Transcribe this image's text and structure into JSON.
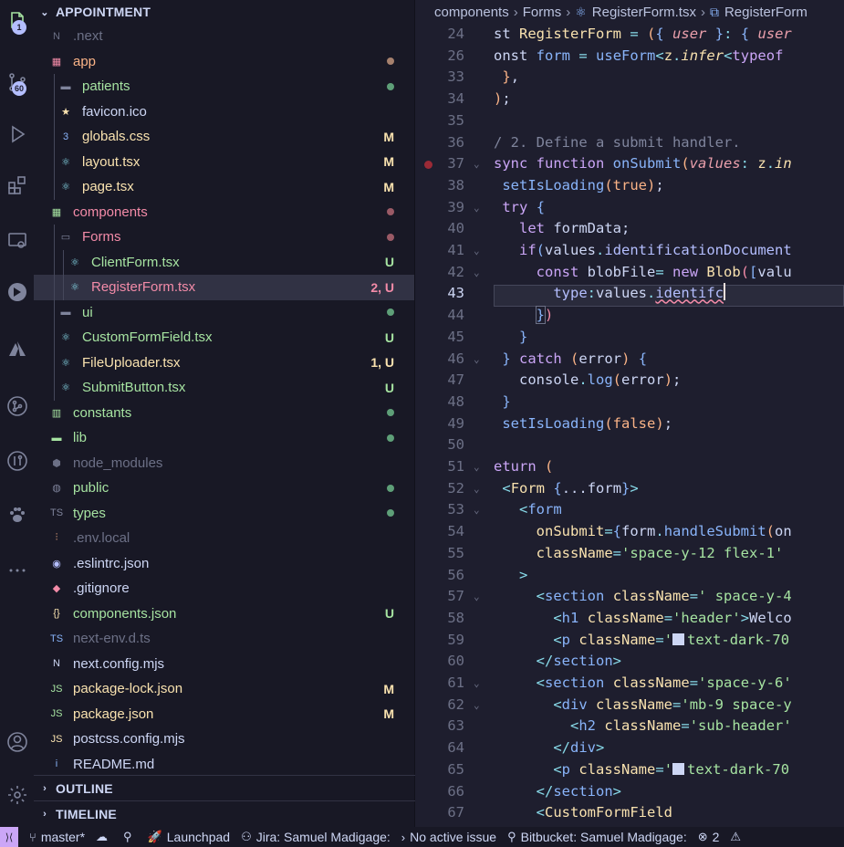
{
  "activity_bar": {
    "items": [
      {
        "icon": "explorer-icon",
        "badge": "1"
      },
      {
        "icon": "source-control-icon",
        "badge": "60"
      },
      {
        "icon": "run-debug-icon",
        "badge": ""
      },
      {
        "icon": "extensions-icon",
        "badge": ""
      },
      {
        "icon": "remote-explorer-icon",
        "badge": ""
      },
      {
        "icon": "gitkraken-icon",
        "badge": ""
      },
      {
        "icon": "atlassian-icon",
        "badge": ""
      },
      {
        "icon": "git-graph-icon",
        "badge": ""
      },
      {
        "icon": "pull-request-icon",
        "badge": ""
      },
      {
        "icon": "paw-icon",
        "badge": ""
      },
      {
        "icon": "more-icon",
        "badge": ""
      }
    ],
    "bottom": [
      {
        "icon": "accounts-icon"
      },
      {
        "icon": "settings-gear-icon"
      }
    ]
  },
  "explorer": {
    "section_title": "APPOINTMENT",
    "items": [
      {
        "label": ".next",
        "icon": "folder-next-icon",
        "icon_glyph": "N",
        "icon_color": "#6c7086",
        "color": "#6c7086",
        "depth": 0,
        "status": "",
        "status_color": "",
        "dot": ""
      },
      {
        "label": "app",
        "icon": "folder-app-icon",
        "icon_glyph": "▦",
        "icon_color": "#f38ba8",
        "color": "#fab387",
        "depth": 0,
        "status": "",
        "status_color": "",
        "dot": "#a6816e"
      },
      {
        "label": "patients",
        "icon": "folder-icon",
        "icon_glyph": "▬",
        "icon_color": "#7f849c",
        "color": "#a6e3a1",
        "depth": 1,
        "status": "",
        "status_color": "",
        "dot": "#5e9f78"
      },
      {
        "label": "favicon.ico",
        "icon": "star-icon",
        "icon_glyph": "★",
        "icon_color": "#f9e2af",
        "color": "#cdd6f4",
        "depth": 1,
        "status": "",
        "status_color": "",
        "dot": ""
      },
      {
        "label": "globals.css",
        "icon": "css-icon",
        "icon_glyph": "3",
        "icon_color": "#89b4fa",
        "color": "#f9e2af",
        "depth": 1,
        "status": "M",
        "status_color": "#f9e2af",
        "dot": ""
      },
      {
        "label": "layout.tsx",
        "icon": "react-icon",
        "icon_glyph": "⚛",
        "icon_color": "#89dceb",
        "color": "#f9e2af",
        "depth": 1,
        "status": "M",
        "status_color": "#f9e2af",
        "dot": ""
      },
      {
        "label": "page.tsx",
        "icon": "react-icon",
        "icon_glyph": "⚛",
        "icon_color": "#89dceb",
        "color": "#f9e2af",
        "depth": 1,
        "status": "M",
        "status_color": "#f9e2af",
        "dot": ""
      },
      {
        "label": "components",
        "icon": "folder-components-icon",
        "icon_glyph": "▦",
        "icon_color": "#a6e3a1",
        "color": "#f38ba8",
        "depth": 0,
        "status": "",
        "status_color": "",
        "dot": "#9a5a66"
      },
      {
        "label": "Forms",
        "icon": "folder-open-icon",
        "icon_glyph": "▭",
        "icon_color": "#7f849c",
        "color": "#f38ba8",
        "depth": 1,
        "status": "",
        "status_color": "",
        "dot": "#9a5a66"
      },
      {
        "label": "ClientForm.tsx",
        "icon": "react-icon",
        "icon_glyph": "⚛",
        "icon_color": "#89dceb",
        "color": "#a6e3a1",
        "depth": 2,
        "status": "U",
        "status_color": "#a6e3a1",
        "dot": ""
      },
      {
        "label": "RegisterForm.tsx",
        "icon": "react-icon",
        "icon_glyph": "⚛",
        "icon_color": "#89dceb",
        "color": "#f38ba8",
        "depth": 2,
        "status": "2, U",
        "status_color": "#f38ba8",
        "dot": "",
        "selected": true
      },
      {
        "label": "ui",
        "icon": "folder-icon",
        "icon_glyph": "▬",
        "icon_color": "#7f849c",
        "color": "#a6e3a1",
        "depth": 1,
        "status": "",
        "status_color": "",
        "dot": "#5e9f78"
      },
      {
        "label": "CustomFormField.tsx",
        "icon": "react-icon",
        "icon_glyph": "⚛",
        "icon_color": "#89dceb",
        "color": "#a6e3a1",
        "depth": 1,
        "status": "U",
        "status_color": "#a6e3a1",
        "dot": ""
      },
      {
        "label": "FileUploader.tsx",
        "icon": "react-icon",
        "icon_glyph": "⚛",
        "icon_color": "#89dceb",
        "color": "#f9e2af",
        "depth": 1,
        "status": "1, U",
        "status_color": "#f9e2af",
        "dot": ""
      },
      {
        "label": "SubmitButton.tsx",
        "icon": "react-icon",
        "icon_glyph": "⚛",
        "icon_color": "#89dceb",
        "color": "#a6e3a1",
        "depth": 1,
        "status": "U",
        "status_color": "#a6e3a1",
        "dot": ""
      },
      {
        "label": "constants",
        "icon": "folder-constants-icon",
        "icon_glyph": "▥",
        "icon_color": "#a6e3a1",
        "color": "#a6e3a1",
        "depth": 0,
        "status": "",
        "status_color": "",
        "dot": "#5e9f78"
      },
      {
        "label": "lib",
        "icon": "folder-lib-icon",
        "icon_glyph": "▬",
        "icon_color": "#a6e3a1",
        "color": "#a6e3a1",
        "depth": 0,
        "status": "",
        "status_color": "",
        "dot": "#5e9f78"
      },
      {
        "label": "node_modules",
        "icon": "folder-node-icon",
        "icon_glyph": "⬢",
        "icon_color": "#6c7086",
        "color": "#6c7086",
        "depth": 0,
        "status": "",
        "status_color": "",
        "dot": ""
      },
      {
        "label": "public",
        "icon": "folder-public-icon",
        "icon_glyph": "◍",
        "icon_color": "#7f849c",
        "color": "#a6e3a1",
        "depth": 0,
        "status": "",
        "status_color": "",
        "dot": "#5e9f78"
      },
      {
        "label": "types",
        "icon": "folder-types-icon",
        "icon_glyph": "TS",
        "icon_color": "#7f849c",
        "color": "#a6e3a1",
        "depth": 0,
        "status": "",
        "status_color": "",
        "dot": "#5e9f78"
      },
      {
        "label": ".env.local",
        "icon": "env-icon",
        "icon_glyph": "⫶",
        "icon_color": "#fab387",
        "color": "#6c7086",
        "depth": 0,
        "status": "",
        "status_color": "",
        "dot": ""
      },
      {
        "label": ".eslintrc.json",
        "icon": "eslint-icon",
        "icon_glyph": "◉",
        "icon_color": "#b4befe",
        "color": "#cdd6f4",
        "depth": 0,
        "status": "",
        "status_color": "",
        "dot": ""
      },
      {
        "label": ".gitignore",
        "icon": "git-icon",
        "icon_glyph": "◆",
        "icon_color": "#f38ba8",
        "color": "#cdd6f4",
        "depth": 0,
        "status": "",
        "status_color": "",
        "dot": ""
      },
      {
        "label": "components.json",
        "icon": "json-icon",
        "icon_glyph": "{}",
        "icon_color": "#f9e2af",
        "color": "#a6e3a1",
        "depth": 0,
        "status": "U",
        "status_color": "#a6e3a1",
        "dot": ""
      },
      {
        "label": "next-env.d.ts",
        "icon": "typescript-def-icon",
        "icon_glyph": "TS",
        "icon_color": "#89b4fa",
        "color": "#6c7086",
        "depth": 0,
        "status": "",
        "status_color": "",
        "dot": ""
      },
      {
        "label": "next.config.mjs",
        "icon": "next-icon",
        "icon_glyph": "N",
        "icon_color": "#cdd6f4",
        "color": "#cdd6f4",
        "depth": 0,
        "status": "",
        "status_color": "",
        "dot": ""
      },
      {
        "label": "package-lock.json",
        "icon": "nodejs-icon",
        "icon_glyph": "JS",
        "icon_color": "#a6e3a1",
        "color": "#f9e2af",
        "depth": 0,
        "status": "M",
        "status_color": "#f9e2af",
        "dot": ""
      },
      {
        "label": "package.json",
        "icon": "nodejs-icon",
        "icon_glyph": "JS",
        "icon_color": "#a6e3a1",
        "color": "#f9e2af",
        "depth": 0,
        "status": "M",
        "status_color": "#f9e2af",
        "dot": ""
      },
      {
        "label": "postcss.config.mjs",
        "icon": "js-icon",
        "icon_glyph": "JS",
        "icon_color": "#f9e2af",
        "color": "#cdd6f4",
        "depth": 0,
        "status": "",
        "status_color": "",
        "dot": ""
      },
      {
        "label": "README.md",
        "icon": "info-icon",
        "icon_glyph": "i",
        "icon_color": "#89b4fa",
        "color": "#cdd6f4",
        "depth": 0,
        "status": "",
        "status_color": "",
        "dot": ""
      }
    ],
    "outline_label": "OUTLINE",
    "timeline_label": "TIMELINE"
  },
  "editor": {
    "breadcrumb": [
      "components",
      "Forms",
      "RegisterForm.tsx",
      "RegisterForm"
    ],
    "current_line": "43",
    "lines": [
      {
        "n": "24",
        "html": "st <span class='ty'>RegisterForm</span> <span class='op'>=</span> <span class='br2'>(</span><span class='br3'>{</span> <span class='it'>user</span> <span class='br3'>}</span><span class='op'>:</span> <span class='br3'>{</span> <span class='it'>user</span>"
      },
      {
        "n": "26",
        "html": "onst <span class='fn'>form</span> <span class='op'>=</span> <span class='fn'>useForm</span><span class='op'>&lt;</span><span class='ty'>z</span><span class='op'>.</span><span class='it' style='color:#f9e2af'>infer</span><span class='op'>&lt;</span><span class='kw'>typeof</span>"
      },
      {
        "n": "33",
        "html": " <span class='br2'>}</span>,"
      },
      {
        "n": "34",
        "html": "<span class='br2'>)</span>;"
      },
      {
        "n": "35",
        "html": ""
      },
      {
        "n": "36",
        "html": "<span class='cm'>/ 2. Define a submit handler.</span>"
      },
      {
        "n": "37",
        "html": "<span class='kw'>sync</span> <span class='kw'>function</span> <span class='fn'>onSubmit</span><span class='br2'>(</span><span class='it'>values</span><span class='op'>:</span> <span class='ty'>z</span><span class='op'>.</span><span class='it' style='color:#f9e2af'>in</span>",
        "bp": true,
        "fold": true
      },
      {
        "n": "38",
        "html": " <span class='fn'>setIsLoading</span><span class='br2'>(</span><span class='br2'>true</span><span class='br2'>)</span>;"
      },
      {
        "n": "39",
        "html": " <span class='kw'>try</span> <span class='br3'>{</span>",
        "fold": true
      },
      {
        "n": "40",
        "html": "   <span class='kw'>let</span> formData;"
      },
      {
        "n": "41",
        "html": "   <span class='kw'>if</span><span class='br3'>(</span>values<span class='op'>.</span><span class='pu' style='color:#b4befe'>identificationDocument</span>",
        "fold": true
      },
      {
        "n": "42",
        "html": "     <span class='kw'>const</span> blobFile<span class='op'>=</span> <span class='kw'>new</span> <span class='ty'>Blob</span><span class='br1'>(</span><span class='br3'>[</span>valu",
        "fold": true
      },
      {
        "n": "43",
        "html": "       <span class='pu' style='color:#b4befe'>type</span><span class='op'>:</span>values<span class='op'>.</span><span class='sq' style='color:#b4befe'>identifc</span><span class='cursor'></span>",
        "cur": true
      },
      {
        "n": "44",
        "html": "     <span class='br3' style='outline:1px solid #6c7086'>}</span><span class='br1'>)</span>"
      },
      {
        "n": "45",
        "html": "   <span class='br3'>}</span>"
      },
      {
        "n": "46",
        "html": " <span class='br3'>}</span> <span class='kw'>catch</span> <span class='br2'>(</span>error<span class='br2'>)</span> <span class='br3'>{</span>",
        "fold": true
      },
      {
        "n": "47",
        "html": "   console<span class='op'>.</span><span class='fn'>log</span><span class='br2'>(</span>error<span class='br2'>)</span>;"
      },
      {
        "n": "48",
        "html": " <span class='br3'>}</span>"
      },
      {
        "n": "49",
        "html": " <span class='fn'>setIsLoading</span><span class='br2'>(</span><span class='br2'>false</span><span class='br2'>)</span>;"
      },
      {
        "n": "50",
        "html": ""
      },
      {
        "n": "51",
        "html": "<span class='kw'>eturn</span> <span class='br2'>(</span>",
        "fold": true
      },
      {
        "n": "52",
        "html": " <span class='op'>&lt;</span><span class='ty'>Form</span> <span class='br3'>{</span>...form<span class='br3'>}</span><span class='op'>&gt;</span>",
        "fold": true
      },
      {
        "n": "53",
        "html": "   <span class='op'>&lt;</span><span class='tag'>form</span>",
        "fold": true
      },
      {
        "n": "54",
        "html": "     <span class='at'>onSubmit</span><span class='op'>=</span><span class='br3'>{</span>form<span class='op'>.</span><span class='fn'>handleSubmit</span><span class='br2'>(</span>on"
      },
      {
        "n": "55",
        "html": "     <span class='at'>className</span><span class='op'>=</span><span class='str'>'space-y-12 flex-1'</span>"
      },
      {
        "n": "56",
        "html": "   <span class='op'>&gt;</span>"
      },
      {
        "n": "57",
        "html": "     <span class='op'>&lt;</span><span class='tag'>section</span> <span class='at'>className</span><span class='op'>=</span><span class='str'>' space-y-4</span>",
        "fold": true
      },
      {
        "n": "58",
        "html": "       <span class='op'>&lt;</span><span class='tag'>h1</span> <span class='at'>className</span><span class='op'>=</span><span class='str'>'header'</span><span class='op'>&gt;</span>Welco"
      },
      {
        "n": "59",
        "html": "       <span class='op'>&lt;</span><span class='tag'>p</span> <span class='at'>className</span><span class='op'>=</span><span class='str'>'<span class='swatch'></span>text-dark-70</span>"
      },
      {
        "n": "60",
        "html": "     <span class='op'>&lt;/</span><span class='tag'>section</span><span class='op'>&gt;</span>"
      },
      {
        "n": "61",
        "html": "     <span class='op'>&lt;</span><span class='tag'>section</span> <span class='at'>className</span><span class='op'>=</span><span class='str'>'space-y-6'</span>",
        "fold": true
      },
      {
        "n": "62",
        "html": "       <span class='op'>&lt;</span><span class='tag'>div</span> <span class='at'>className</span><span class='op'>=</span><span class='str'>'mb-9 space-y</span>",
        "fold": true
      },
      {
        "n": "63",
        "html": "         <span class='op'>&lt;</span><span class='tag'>h2</span> <span class='at'>className</span><span class='op'>=</span><span class='str'>'sub-header'</span>"
      },
      {
        "n": "64",
        "html": "       <span class='op'>&lt;/</span><span class='tag'>div</span><span class='op'>&gt;</span>"
      },
      {
        "n": "65",
        "html": "       <span class='op'>&lt;</span><span class='tag'>p</span> <span class='at'>className</span><span class='op'>=</span><span class='str'>'<span class='swatch'></span>text-dark-70</span>"
      },
      {
        "n": "66",
        "html": "     <span class='op'>&lt;/</span><span class='tag'>section</span><span class='op'>&gt;</span>"
      },
      {
        "n": "67",
        "html": "     <span class='op'>&lt;</span><span class='ty'>CustomFormField</span>"
      }
    ]
  },
  "statusbar": {
    "remote_icon": "remote-icon",
    "items": [
      {
        "icon": "branch-icon",
        "glyph": "⑂",
        "label": "master*"
      },
      {
        "icon": "sync-icon",
        "glyph": "☁",
        "label": ""
      },
      {
        "icon": "git-graph-status-icon",
        "glyph": "⚲",
        "label": ""
      },
      {
        "icon": "launchpad-icon",
        "glyph": "🚀",
        "label": "Launchpad"
      },
      {
        "icon": "jira-icon",
        "glyph": "⚇",
        "label": "Jira: Samuel Madigage:"
      },
      {
        "icon": "chevron-right-icon",
        "glyph": "›",
        "label": "No active issue"
      },
      {
        "icon": "bitbucket-icon",
        "glyph": "⚲",
        "label": "Bitbucket: Samuel Madigage:"
      },
      {
        "icon": "error-icon",
        "glyph": "⊗",
        "label": "2"
      },
      {
        "icon": "warning-icon",
        "glyph": "⚠",
        "label": ""
      }
    ]
  },
  "colors": {
    "bg": "#1e1e2e",
    "sidebar_bg": "#181825",
    "accent": "#cba6f7",
    "modified": "#f9e2af",
    "untracked": "#a6e3a1",
    "error": "#f38ba8"
  }
}
